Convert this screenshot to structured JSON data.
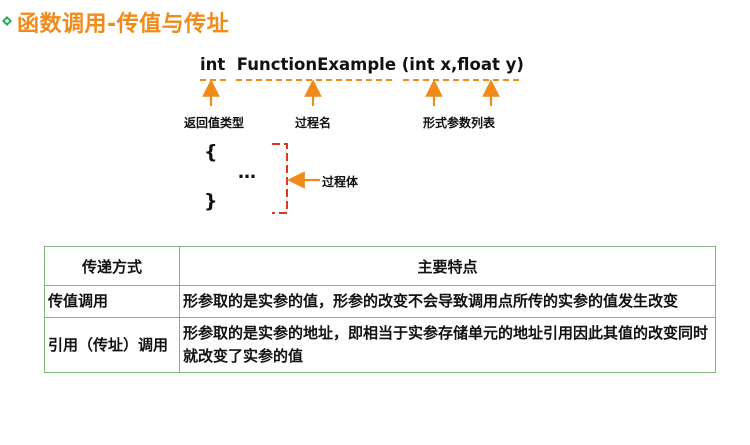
{
  "title": "函数调用-传值与传址",
  "colors": {
    "accent": "#f08a19",
    "arrow": "#f08a19",
    "bracket": "#e0361c",
    "table_border": "#7fb77a",
    "bullet": "#26a85a"
  },
  "signature": {
    "text": "int  FunctionExample (int x,float y)"
  },
  "labels": {
    "return_type": "返回值类型",
    "proc_name": "过程名",
    "params": "形式参数列表",
    "body": "过程体"
  },
  "body": {
    "open": "{",
    "ellipsis": "…",
    "close": "}"
  },
  "table": {
    "headers": [
      "传递方式",
      "主要特点"
    ],
    "rows": [
      {
        "mode": "传值调用",
        "desc": "形参取的是实参的值，形参的改变不会导致调用点所传的实参的值发生改变"
      },
      {
        "mode": "引用（传址）调用",
        "desc": "形参取的是实参的地址，即相当于实参存储单元的地址引用因此其值的改变同时就改变了实参的值"
      }
    ]
  }
}
